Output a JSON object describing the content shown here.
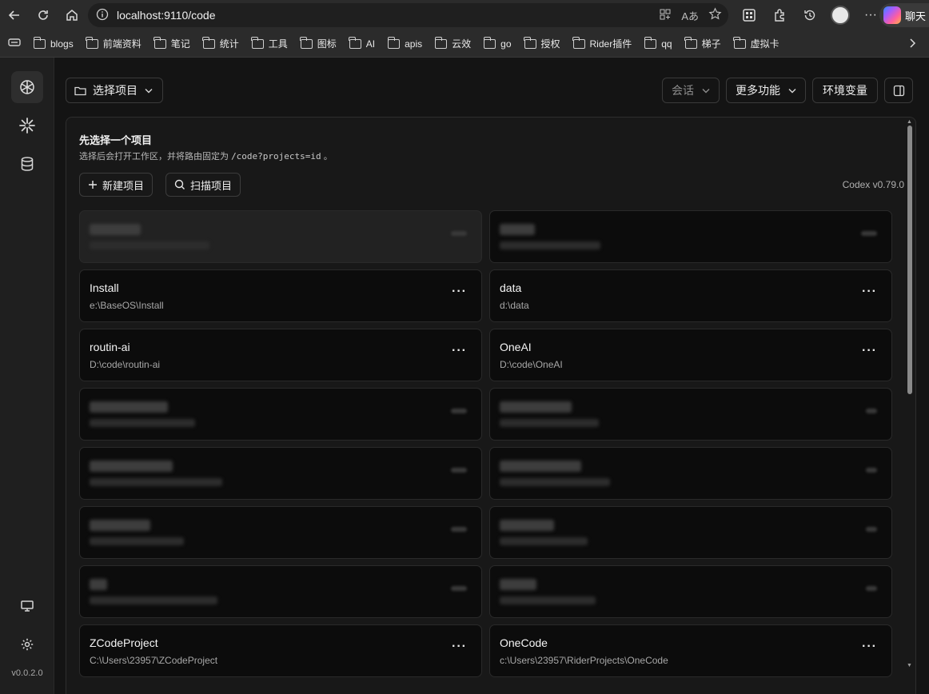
{
  "browser": {
    "url": "localhost:9110/code",
    "copilot_label": "聊天",
    "bookmarks": [
      "blogs",
      "前端资料",
      "笔记",
      "统计",
      "工具",
      "图标",
      "AI",
      "apis",
      "云效",
      "go",
      "授权",
      "Rider插件",
      "qq",
      "梯子",
      "虚拟卡"
    ]
  },
  "sidebar": {
    "version": "v0.0.2.0"
  },
  "header": {
    "project_select_label": "选择项目",
    "session_label": "会话",
    "more_label": "更多功能",
    "env_label": "环境变量"
  },
  "panel": {
    "title": "先选择一个项目",
    "subtitle_prefix": "选择后会打开工作区，并将路由固定为 ",
    "subtitle_code": "/code?projects=id",
    "subtitle_suffix": " 。",
    "new_project_label": "新建项目",
    "scan_project_label": "扫描项目",
    "codex_version": "Codex v0.79.0"
  },
  "projects": [
    {
      "name": "Install",
      "path": "e:\\BaseOS\\Install"
    },
    {
      "name": "data",
      "path": "d:\\data"
    },
    {
      "name": "routin-ai",
      "path": "D:\\code\\routin-ai"
    },
    {
      "name": "OneAI",
      "path": "D:\\code\\OneAI"
    },
    {
      "name": "ZCodeProject",
      "path": "C:\\Users\\23957\\ZCodeProject"
    },
    {
      "name": "OneCode",
      "path": "c:\\Users\\23957\\RiderProjects\\OneCode"
    }
  ],
  "colors": {
    "background": "#141414",
    "panel": "#181818",
    "card": "#0c0c0c",
    "accent_text": "#f5f5f5"
  }
}
